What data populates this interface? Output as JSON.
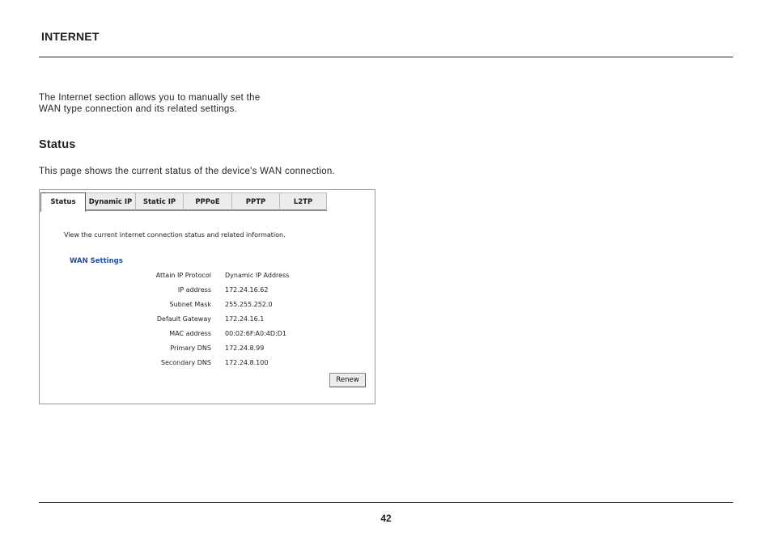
{
  "header": {
    "title": "INTERNET"
  },
  "intro": {
    "line1": "The Internet section allows you to manually set the",
    "line2": "WAN type connection and its related settings."
  },
  "status_section": {
    "heading": "Status",
    "description": "This page shows the current status of the device's WAN connection."
  },
  "screenshot": {
    "tabs": [
      {
        "label": "Status",
        "active": true
      },
      {
        "label": "Dynamic IP",
        "active": false
      },
      {
        "label": "Static IP",
        "active": false
      },
      {
        "label": "PPPoE",
        "active": false
      },
      {
        "label": "PPTP",
        "active": false
      },
      {
        "label": "L2TP",
        "active": false
      }
    ],
    "description": "View the current internet connection status and related information.",
    "wan_title": "WAN Settings",
    "rows": [
      {
        "label": "Attain IP Protocol",
        "value": "Dynamic IP Address"
      },
      {
        "label": "IP address",
        "value": "172.24.16.62"
      },
      {
        "label": "Subnet Mask",
        "value": "255.255.252.0"
      },
      {
        "label": "Default Gateway",
        "value": "172.24.16.1"
      },
      {
        "label": "MAC address",
        "value": "00:02:6F:A0:4D:D1"
      },
      {
        "label": "Primary DNS",
        "value": "172.24.8.99"
      },
      {
        "label": "Secondary DNS",
        "value": "172.24.8.100"
      }
    ],
    "renew_label": "Renew"
  },
  "footer": {
    "page_number": "42"
  },
  "colors": {
    "wan_title": "#1f4ea8"
  }
}
